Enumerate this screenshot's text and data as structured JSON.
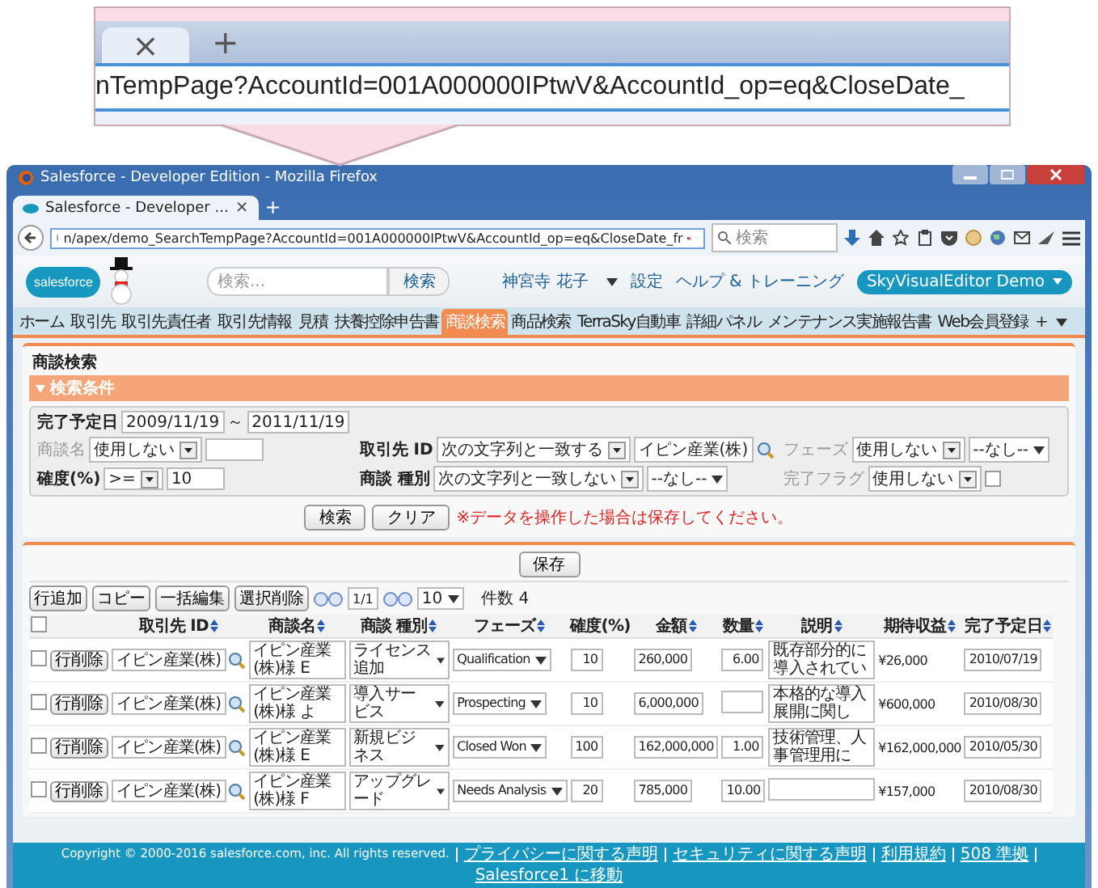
{
  "callout": {
    "tab_close": "×",
    "new_tab": "+",
    "url": "nTempPage?AccountId=001A000000IPtwV&AccountId_op=eq&CloseDate_"
  },
  "window": {
    "title": "Salesforce - Developer Edition - Mozilla Firefox"
  },
  "browser_tab": {
    "label": "Salesforce - Developer ...",
    "close": "×",
    "new_tab": "+"
  },
  "address_bar": {
    "url": "n/apex/demo_SearchTempPage?AccountId=001A000000IPtwV&AccountId_op=eq&CloseDate_fr"
  },
  "search_bar": {
    "placeholder": "検索"
  },
  "header": {
    "logo": "salesforce",
    "search_placeholder": "検索...",
    "search_button": "検索",
    "user": "神宮寺 花子",
    "setup": "設定",
    "help": "ヘルプ & トレーニング",
    "app": "SkyVisualEditor Demo"
  },
  "tabs": [
    {
      "label": "ホーム",
      "selected": false
    },
    {
      "label": "取引先",
      "selected": false
    },
    {
      "label": "取引先責任者",
      "selected": false
    },
    {
      "label": "取引先情報",
      "selected": false
    },
    {
      "label": "見積",
      "selected": false
    },
    {
      "label": "扶養控除申告書",
      "selected": false
    },
    {
      "label": "商談検索",
      "selected": true
    },
    {
      "label": "商品検索",
      "selected": false
    },
    {
      "label": "TerraSky自動車",
      "selected": false
    },
    {
      "label": "詳細パネル",
      "selected": false
    },
    {
      "label": "メンテナンス実施報告書",
      "selected": false
    },
    {
      "label": "Web会員登録",
      "selected": false
    }
  ],
  "tab_plus": "+",
  "page_title": "商談検索",
  "criteria": {
    "title": "検索条件",
    "rows": [
      [
        {
          "kind": "date_range",
          "label": "完了予定日",
          "active": true,
          "from": "2009/11/19",
          "separator": "～",
          "to": "2011/11/19"
        }
      ],
      [
        {
          "kind": "text",
          "label": "商談名",
          "active": false,
          "operator": "使用しない"
        },
        {
          "kind": "lookup",
          "label": "取引先 ID",
          "active": true,
          "operator": "次の文字列と一致する",
          "value": "イピン産業(株)"
        },
        {
          "kind": "select",
          "label": "フェーズ",
          "active": false,
          "operator": "使用しない",
          "value": "--なし--"
        }
      ],
      [
        {
          "kind": "text",
          "label": "確度(%)",
          "active": true,
          "operator": ">=",
          "value": "10"
        },
        {
          "kind": "select",
          "label": "商談 種別",
          "active": true,
          "operator": "次の文字列と一致しない",
          "value": "--なし--"
        },
        {
          "kind": "checkbox",
          "label": "完了フラグ",
          "active": false,
          "operator": "使用しない",
          "checked": false
        }
      ]
    ]
  },
  "actions": {
    "search": "検索",
    "clear": "クリア",
    "note": "※データを操作した場合は保存してください。"
  },
  "save": "保存",
  "toolbar": {
    "buttons": [
      "行追加",
      "コピー",
      "一括編集",
      "選択削除"
    ],
    "page": "1/1",
    "page_size": "10",
    "count": "件数 4"
  },
  "table": {
    "select_all_checked": false,
    "columns": [
      {
        "label": "取引先 ID",
        "sortable": true
      },
      {
        "label": "商談名",
        "sortable": true
      },
      {
        "label": "商談 種別",
        "sortable": true
      },
      {
        "label": "フェーズ",
        "sortable": true
      },
      {
        "label": "確度(%)",
        "sortable": false
      },
      {
        "label": "金額",
        "sortable": true
      },
      {
        "label": "数量",
        "sortable": true
      },
      {
        "label": "説明",
        "sortable": true
      },
      {
        "label": "期待収益",
        "sortable": true
      },
      {
        "label": "完了予定日",
        "sortable": true
      }
    ],
    "rows": [
      {
        "checked": false,
        "delete": "行削除",
        "account": "イピン産業(株)",
        "name": "イピン産業(株)様 E",
        "type": "ライセンス追加",
        "phase": "Qualification",
        "probability": "10",
        "amount": "260,000",
        "quantity": "6.00",
        "description": "既存部分的に導入されてい",
        "expected_revenue": "¥26,000",
        "close_date": "2010/07/19"
      },
      {
        "checked": false,
        "delete": "行削除",
        "account": "イピン産業(株)",
        "name": "イピン産業(株)様 よ",
        "type": "導入サービス",
        "phase": "Prospecting",
        "probability": "10",
        "amount": "6,000,000",
        "description": "本格的な導入展開に関し",
        "expected_revenue": "¥600,000",
        "close_date": "2010/08/30"
      },
      {
        "checked": false,
        "delete": "行削除",
        "account": "イピン産業(株)",
        "name": "イピン産業(株)様 E",
        "type": "新規ビジネス",
        "phase": "Closed Won",
        "probability": "100",
        "amount": "162,000,000",
        "quantity": "1.00",
        "description": "技術管理、人事管理用に",
        "expected_revenue": "¥162,000,000",
        "close_date": "2010/05/30"
      },
      {
        "checked": false,
        "delete": "行削除",
        "account": "イピン産業(株)",
        "name": "イピン産業(株)様 F",
        "type": "アップグレード",
        "phase": "Needs Analysis",
        "probability": "20",
        "amount": "785,000",
        "quantity": "10.00",
        "expected_revenue": "¥157,000",
        "close_date": "2010/08/30"
      }
    ]
  },
  "footer": {
    "copyright": "Copyright © 2000-2016 salesforce.com, inc. All rights reserved.",
    "links": [
      "プライバシーに関する声明",
      "セキュリティに関する声明",
      "利用規約",
      "508 準拠",
      "Salesforce1 に移動"
    ]
  }
}
